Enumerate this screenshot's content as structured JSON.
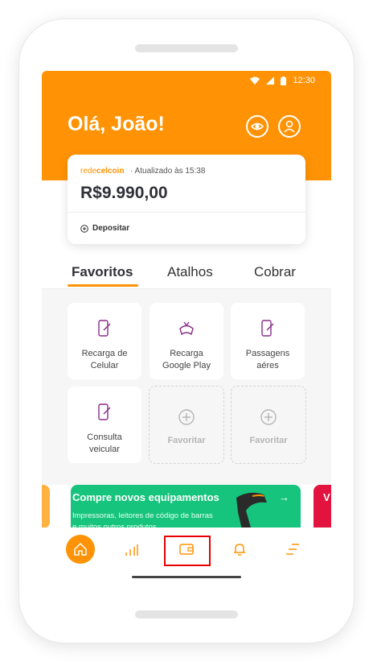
{
  "status_bar": {
    "time": "12:30"
  },
  "header": {
    "greeting": "Olá, João!"
  },
  "balance_card": {
    "brand_prefix": "rede",
    "brand_suffix": "celcoin",
    "updated": "·  Atualizado às 15:38",
    "amount": "R$9.990,00",
    "deposit_label": "Depositar"
  },
  "tabs": [
    {
      "label": "Favoritos",
      "active": true
    },
    {
      "label": "Atalhos",
      "active": false
    },
    {
      "label": "Cobrar",
      "active": false
    }
  ],
  "favorites": [
    {
      "label": "Recarga de\nCelular",
      "icon": "phone-recharge-icon"
    },
    {
      "label": "Recarga\nGoogle Play",
      "icon": "gamepad-icon"
    },
    {
      "label": "Passagens\naéres",
      "icon": "ticket-icon"
    },
    {
      "label": "Consulta\nveicular",
      "icon": "vehicle-check-icon"
    },
    {
      "label": "Favoritar",
      "icon": "add-circle-icon"
    },
    {
      "label": "Favoritar",
      "icon": "add-circle-icon"
    }
  ],
  "banner": {
    "title": "Compre novos equipamentos",
    "text": "Impressoras, leitores de código de barras e muitos outros produtos",
    "right_peek": "V"
  },
  "colors": {
    "accent": "#ff9305",
    "banner_green": "#17c47d",
    "banner_red": "#e2133f",
    "highlight": "#e60000"
  },
  "navbar": [
    "home-icon",
    "chart-icon",
    "wallet-icon",
    "bell-icon",
    "menu-icon"
  ]
}
